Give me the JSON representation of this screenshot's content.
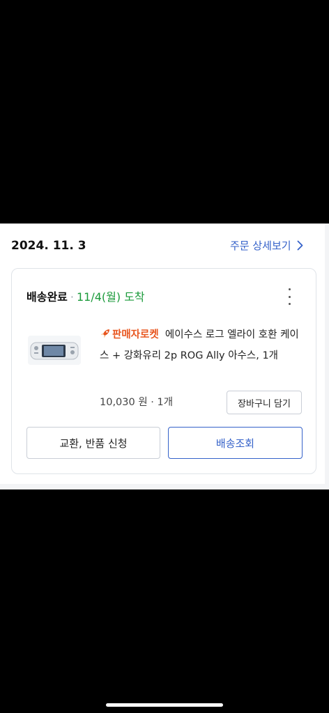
{
  "order": {
    "date": "2024. 11. 3",
    "detail_link": "주문 상세보기"
  },
  "delivery": {
    "status": "배송완료",
    "separator": "·",
    "arrival": "11/4(월) 도착"
  },
  "product": {
    "badge": "판매자로켓",
    "name": "에이수스 로그 엘라이 호환 케이스 + 강화유리 2p ROG Ally 아수스, 1개",
    "price_qty": "10,030 원 · 1개"
  },
  "buttons": {
    "add_to_cart": "장바구니 담기",
    "exchange_return": "교환, 반품 신청",
    "track_delivery": "배송조회"
  },
  "colors": {
    "accent": "#3461c9",
    "arrival": "#1a9a3a",
    "rocket": "#e8561f"
  },
  "icons": {
    "detail": "chevron-right-icon",
    "more": "more-vertical-icon",
    "rocket": "rocket-icon"
  }
}
